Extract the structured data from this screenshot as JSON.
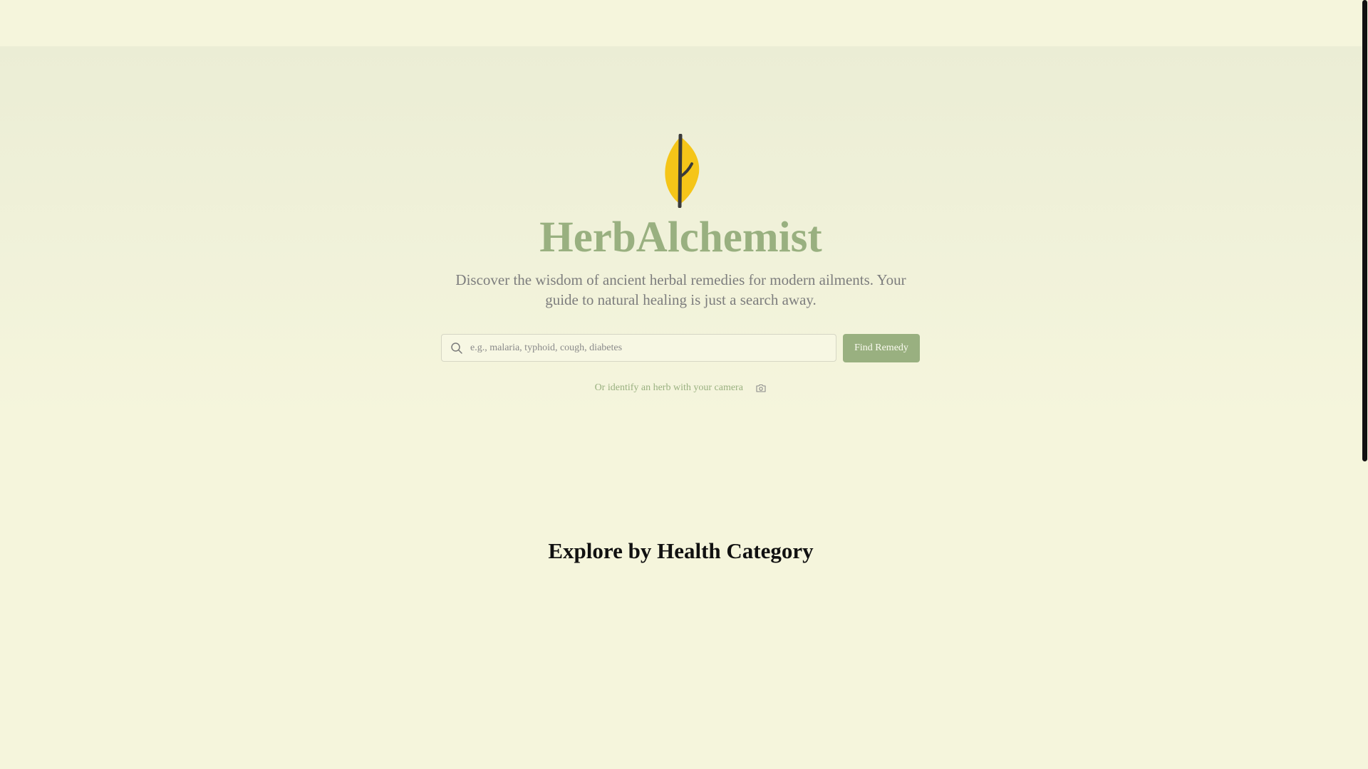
{
  "app": {
    "title": "HerbAlchemist",
    "subtitle": "Discover the wisdom of ancient herbal remedies for modern ailments. Your guide to natural healing is just a search away."
  },
  "search": {
    "placeholder": "e.g., malaria, typhoid, cough, diabetes",
    "value": "",
    "button_label": "Find Remedy",
    "icon": "search-icon"
  },
  "camera": {
    "label": "Or identify an herb with your camera",
    "icon": "camera-icon"
  },
  "categories": {
    "heading": "Explore by Health Category"
  },
  "logo": {
    "icon": "leaf-icon"
  },
  "colors": {
    "background": "#f5f5dc",
    "accent_green": "#99b080",
    "leaf_yellow": "#f5c518",
    "leaf_stem": "#3a3a3a",
    "subtitle_gray": "#7d7d7d"
  }
}
